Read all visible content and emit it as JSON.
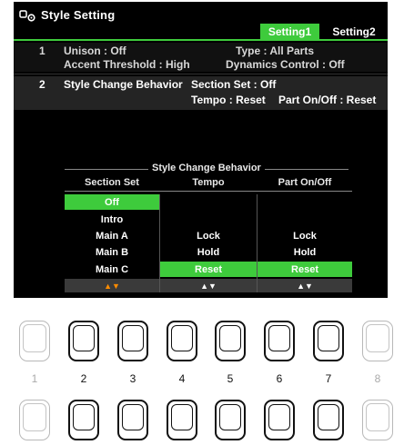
{
  "header": {
    "title": "Style Setting",
    "icon": "style-setting-icon"
  },
  "tabs": [
    {
      "label": "Setting1",
      "selected": true
    },
    {
      "label": "Setting2",
      "selected": false
    }
  ],
  "rows": [
    {
      "number": "1",
      "items": [
        {
          "label": "Unison : Off"
        },
        {
          "label": "Type : All Parts"
        },
        {
          "label": "Accent Threshold : High"
        },
        {
          "label": "Dynamics Control : Off"
        }
      ]
    },
    {
      "number": "2",
      "name": "Style Change Behavior",
      "items": [
        {
          "label": "Section Set : Off"
        },
        {
          "label": "Tempo : Reset"
        },
        {
          "label": "Part On/Off : Reset"
        }
      ]
    }
  ],
  "panel": {
    "title": "Style Change Behavior",
    "columns": [
      {
        "header": "Section Set",
        "options": [
          "Off",
          "Intro",
          "Main A",
          "Main B",
          "Main C"
        ],
        "selected": "Off",
        "arrows": "▲▼",
        "arrow_color": "#ff8c00"
      },
      {
        "header": "Tempo",
        "options": [
          "Lock",
          "Hold",
          "Reset"
        ],
        "selected": "Reset",
        "arrows": "▲▼",
        "arrow_color": "#ffffff"
      },
      {
        "header": "Part On/Off",
        "options": [
          "Lock",
          "Hold",
          "Reset"
        ],
        "selected": "Reset",
        "arrows": "▲▼",
        "arrow_color": "#ffffff"
      }
    ]
  },
  "hardware_buttons": {
    "numbers": [
      "1",
      "2",
      "3",
      "4",
      "5",
      "6",
      "7",
      "8"
    ],
    "enabled": [
      false,
      true,
      true,
      true,
      true,
      true,
      true,
      false
    ]
  },
  "colors": {
    "accent_green": "#3ecb3c",
    "screen_bg": "#000000",
    "arrow_orange": "#ff8c00"
  }
}
